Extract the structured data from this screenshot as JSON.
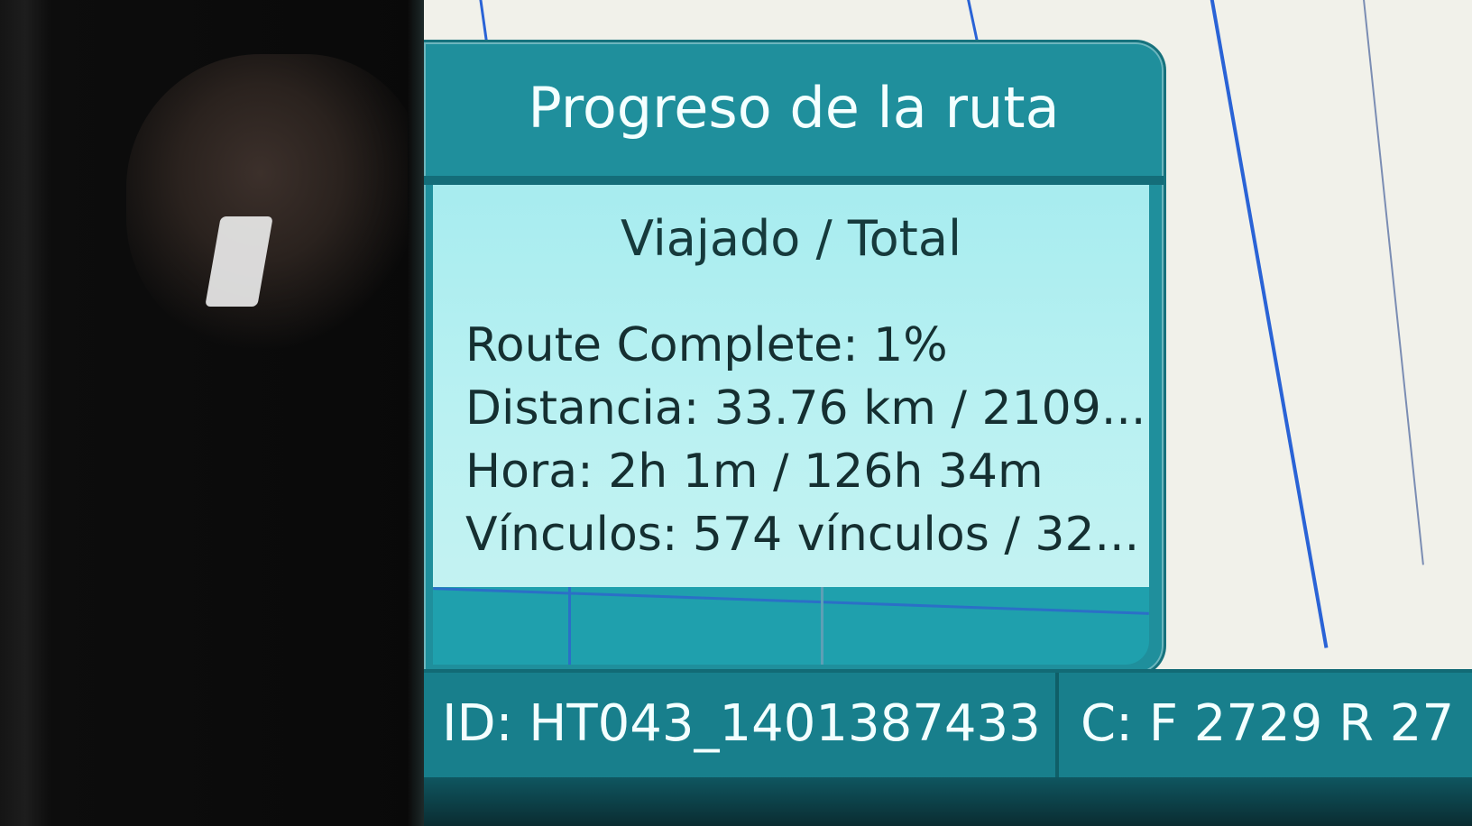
{
  "panel": {
    "title": "Progreso de la ruta",
    "subtitle": "Viajado / Total",
    "stats": [
      "Route Complete: 1%",
      "Distancia: 33.76 km / 2109...",
      "Hora: 2h 1m / 126h 34m",
      "Vínculos: 574 vínculos / 32..."
    ]
  },
  "status_bar": {
    "id_text": "ID: HT043_1401387433",
    "c_text": "C: F 2729 R 27"
  },
  "colors": {
    "panel_header": "#1f8f9c",
    "panel_body": "#b9f1f2",
    "map_background": "#f1f1ea",
    "route_line": "#2a63d6",
    "status_bar": "#187f8c"
  }
}
